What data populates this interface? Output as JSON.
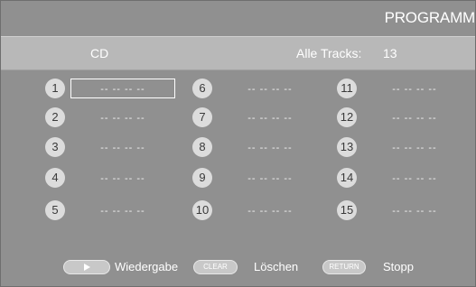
{
  "header": {
    "title": "PROGRAMM"
  },
  "info": {
    "disc_type": "CD",
    "total_label": "Alle Tracks:",
    "total_value": "13"
  },
  "slots": [
    {
      "number": "1",
      "value": "-- -- -- --"
    },
    {
      "number": "2",
      "value": "-- -- -- --"
    },
    {
      "number": "3",
      "value": "-- -- -- --"
    },
    {
      "number": "4",
      "value": "-- -- -- --"
    },
    {
      "number": "5",
      "value": "-- -- -- --"
    },
    {
      "number": "6",
      "value": "-- -- -- --"
    },
    {
      "number": "7",
      "value": "-- -- -- --"
    },
    {
      "number": "8",
      "value": "-- -- -- --"
    },
    {
      "number": "9",
      "value": "-- -- -- --"
    },
    {
      "number": "10",
      "value": "-- -- -- --"
    },
    {
      "number": "11",
      "value": "-- -- -- --"
    },
    {
      "number": "12",
      "value": "-- -- -- --"
    },
    {
      "number": "13",
      "value": "-- -- -- --"
    },
    {
      "number": "14",
      "value": "-- -- -- --"
    },
    {
      "number": "15",
      "value": "-- -- -- --"
    }
  ],
  "footer": {
    "play_icon": "play-icon",
    "play_label": "Wiedergabe",
    "clear_key": "CLEAR",
    "clear_label": "Löschen",
    "return_key": "RETURN",
    "return_label": "Stopp"
  }
}
